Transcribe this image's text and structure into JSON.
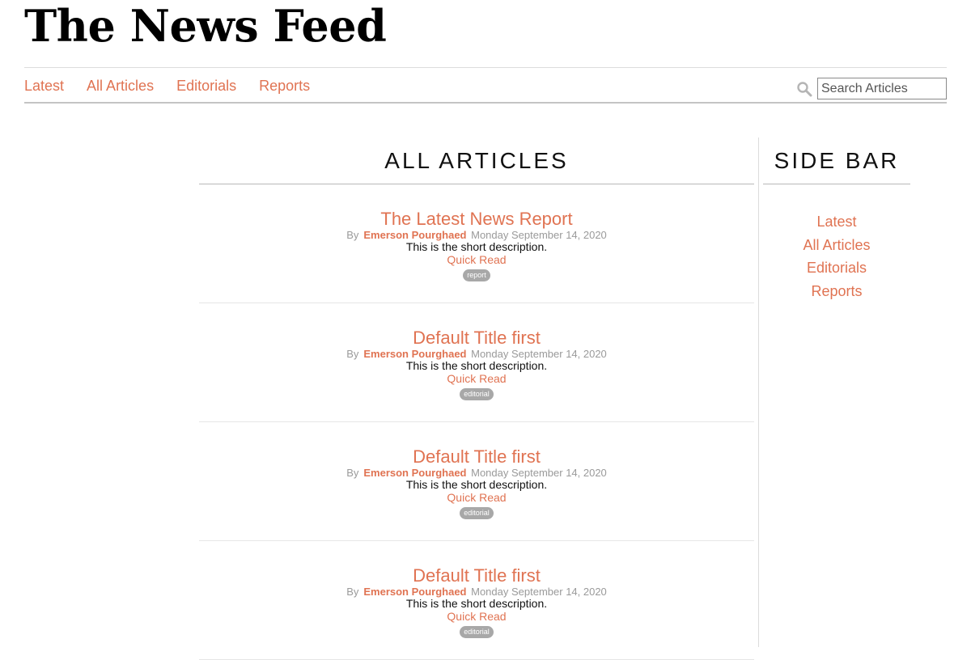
{
  "site": {
    "title": "The News Feed"
  },
  "nav": {
    "links": [
      "Latest",
      "All Articles",
      "Editorials",
      "Reports"
    ],
    "search_placeholder": "Search Articles",
    "search_icon": "search-icon"
  },
  "main": {
    "heading": "ALL ARTICLES",
    "articles": [
      {
        "title": "The Latest News Report",
        "by": "By",
        "author": "Emerson Pourghaed",
        "date": "Monday September 14, 2020",
        "description": "This is the short description.",
        "link": "Quick Read",
        "tag": "report"
      },
      {
        "title": "Default Title first",
        "by": "By",
        "author": "Emerson Pourghaed",
        "date": "Monday September 14, 2020",
        "description": "This is the short description.",
        "link": "Quick Read",
        "tag": "editorial"
      },
      {
        "title": "Default Title first",
        "by": "By",
        "author": "Emerson Pourghaed",
        "date": "Monday September 14, 2020",
        "description": "This is the short description.",
        "link": "Quick Read",
        "tag": "editorial"
      },
      {
        "title": "Default Title first",
        "by": "By",
        "author": "Emerson Pourghaed",
        "date": "Monday September 14, 2020",
        "description": "This is the short description.",
        "link": "Quick Read",
        "tag": "editorial"
      }
    ]
  },
  "sidebar": {
    "heading": "SIDE BAR",
    "links": [
      "Latest",
      "All Articles",
      "Editorials",
      "Reports"
    ]
  },
  "colors": {
    "accent": "#e07352",
    "muted": "#9a9a9a",
    "tag_bg": "#a8a8a8"
  }
}
